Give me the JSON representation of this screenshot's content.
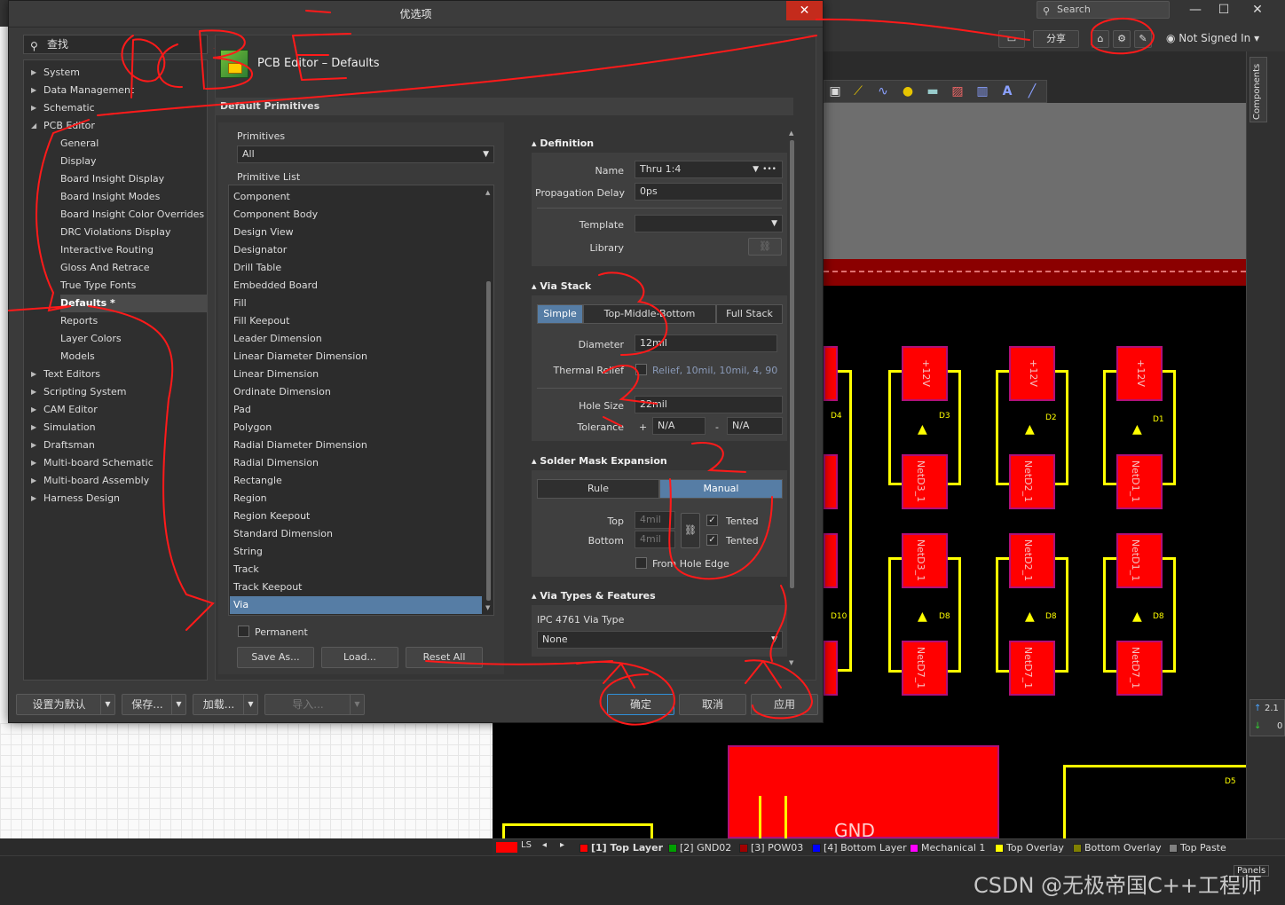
{
  "app": {
    "search_placeholder": "Search",
    "win_minimize": "—",
    "win_maximize": "☐",
    "win_close": "✕",
    "share_label": "分享",
    "not_signed_in": "Not Signed In",
    "components_tab": "Components",
    "coord_up": "2.1",
    "coord_down": "0",
    "panels_label": "Panels",
    "watermark": "CSDN @无极帝国C++工程师"
  },
  "layers": {
    "ls_label": "LS",
    "tabs": [
      {
        "label": "[1] Top Layer",
        "color": "#ff0000"
      },
      {
        "label": "[2] GND02",
        "color": "#00a000"
      },
      {
        "label": "[3] POW03",
        "color": "#a00000"
      },
      {
        "label": "[4] Bottom Layer",
        "color": "#0000ff"
      },
      {
        "label": "Mechanical 1",
        "color": "#ff00ff"
      },
      {
        "label": "Top Overlay",
        "color": "#ffff00"
      },
      {
        "label": "Bottom Overlay",
        "color": "#808000"
      },
      {
        "label": "Top Paste",
        "color": "#808080"
      }
    ]
  },
  "pcb": {
    "pads": [
      "+12V",
      "+12V",
      "+12V",
      "NetD3_1",
      "NetD2_1",
      "NetD1_1",
      "NetD3_1",
      "NetD2_1",
      "NetD1_1",
      "NetD7_1",
      "NetD7_1",
      "NetD7_1"
    ],
    "designators": [
      "D3",
      "D2",
      "D1",
      "D4",
      "D10",
      "D8",
      "D8",
      "D8",
      "D5"
    ],
    "gnd_label": "GND"
  },
  "dialog": {
    "title": "优选项",
    "close": "✕",
    "search_placeholder": "查找",
    "tree": [
      {
        "label": "System",
        "level": 0,
        "expandable": true
      },
      {
        "label": "Data Management",
        "level": 0,
        "expandable": true
      },
      {
        "label": "Schematic",
        "level": 0,
        "expandable": true
      },
      {
        "label": "PCB Editor",
        "level": 0,
        "expandable": true,
        "expanded": true
      },
      {
        "label": "General",
        "level": 1
      },
      {
        "label": "Display",
        "level": 1
      },
      {
        "label": "Board Insight Display",
        "level": 1
      },
      {
        "label": "Board Insight Modes",
        "level": 1
      },
      {
        "label": "Board Insight Color Overrides",
        "level": 1
      },
      {
        "label": "DRC Violations Display",
        "level": 1
      },
      {
        "label": "Interactive Routing",
        "level": 1
      },
      {
        "label": "Gloss And Retrace",
        "level": 1
      },
      {
        "label": "True Type Fonts",
        "level": 1
      },
      {
        "label": "Defaults *",
        "level": 1,
        "selected": true
      },
      {
        "label": "Reports",
        "level": 1
      },
      {
        "label": "Layer Colors",
        "level": 1
      },
      {
        "label": "Models",
        "level": 1
      },
      {
        "label": "Text Editors",
        "level": 0,
        "expandable": true
      },
      {
        "label": "Scripting System",
        "level": 0,
        "expandable": true
      },
      {
        "label": "CAM Editor",
        "level": 0,
        "expandable": true
      },
      {
        "label": "Simulation",
        "level": 0,
        "expandable": true
      },
      {
        "label": "Draftsman",
        "level": 0,
        "expandable": true
      },
      {
        "label": "Multi-board Schematic",
        "level": 0,
        "expandable": true
      },
      {
        "label": "Multi-board Assembly",
        "level": 0,
        "expandable": true
      },
      {
        "label": "Harness Design",
        "level": 0,
        "expandable": true
      }
    ],
    "page_title": "PCB Editor – Defaults",
    "section_title": "Default Primitives",
    "primitives_label": "Primitives",
    "primitives_value": "All",
    "primitive_list_label": "Primitive List",
    "primitive_list": [
      "Component",
      "Component Body",
      "Design View",
      "Designator",
      "Drill Table",
      "Embedded Board",
      "Fill",
      "Fill Keepout",
      "Leader Dimension",
      "Linear Diameter Dimension",
      "Linear Dimension",
      "Ordinate Dimension",
      "Pad",
      "Polygon",
      "Radial Diameter Dimension",
      "Radial Dimension",
      "Rectangle",
      "Region",
      "Region Keepout",
      "Standard Dimension",
      "String",
      "Track",
      "Track Keepout",
      "Via"
    ],
    "selected_primitive": "Via",
    "permanent_label": "Permanent",
    "save_as": "Save As...",
    "load": "Load...",
    "reset_all": "Reset All",
    "definition": {
      "header": "Definition",
      "name_label": "Name",
      "name_value": "Thru 1:4",
      "more": "•••",
      "prop_delay_label": "Propagation Delay",
      "prop_delay_value": "0ps",
      "template_label": "Template",
      "template_value": "",
      "library_label": "Library",
      "link_icon": "⛓"
    },
    "via_stack": {
      "header": "Via Stack",
      "modes": [
        "Simple",
        "Top-Middle-Bottom",
        "Full Stack"
      ],
      "active_mode": "Simple",
      "diameter_label": "Diameter",
      "diameter_value": "12mil",
      "thermal_label": "Thermal Relief",
      "thermal_value": "Relief, 10mil, 10mil, 4, 90",
      "hole_label": "Hole Size",
      "hole_value": "22mil",
      "tolerance_label": "Tolerance",
      "tol_plus": "+",
      "tol_plus_value": "N/A",
      "tol_minus": "-",
      "tol_minus_value": "N/A"
    },
    "solder_mask": {
      "header": "Solder Mask Expansion",
      "modes": [
        "Rule",
        "Manual"
      ],
      "active_mode": "Manual",
      "top_label": "Top",
      "top_value": "4mil",
      "bottom_label": "Bottom",
      "bottom_value": "4mil",
      "tented_top": "Tented",
      "tented_bottom": "Tented",
      "from_hole_edge": "From Hole Edge"
    },
    "via_types": {
      "header": "Via Types & Features",
      "ipc_label": "IPC 4761 Via Type",
      "ipc_value": "None"
    },
    "footer": {
      "set_default": "设置为默认",
      "save": "保存...",
      "load": "加载...",
      "import": "导入...",
      "ok": "确定",
      "cancel": "取消",
      "apply": "应用"
    }
  },
  "annotations": {
    "pcb": "PCB",
    "e": "E",
    "n1": "1",
    "n2": "2",
    "n3": "3"
  }
}
